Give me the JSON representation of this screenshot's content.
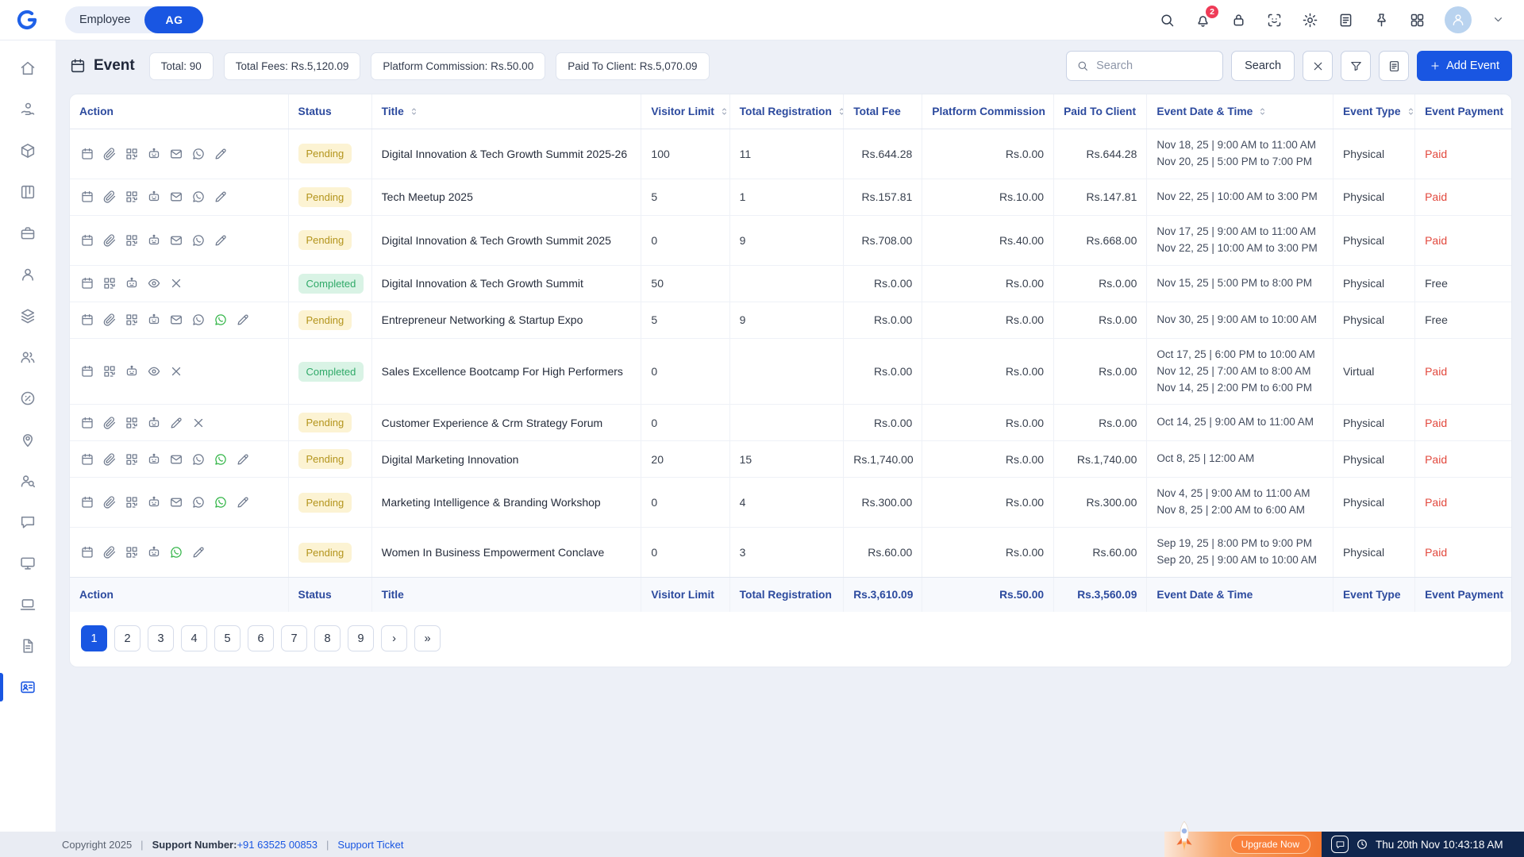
{
  "colors": {
    "accent": "#1956e2",
    "table_header_text": "#2c4a9e",
    "pending_bg": "#fcf3d3",
    "pending_text": "#b3941c",
    "completed_bg": "#d9f3e5",
    "completed_text": "#2fa968",
    "paid_text": "#e2483d",
    "status_bar_navy": "#10264d",
    "upgrade_orange": "#f2762e"
  },
  "topbar": {
    "workspace_tabs": {
      "employee": "Employee",
      "initials": "AG"
    },
    "notification_badge": "2",
    "icons": [
      {
        "icon": "search",
        "name": "topbar-search-button"
      },
      {
        "icon": "bell",
        "name": "notifications-button",
        "badge": "2"
      },
      {
        "icon": "lock",
        "name": "lock-button"
      },
      {
        "icon": "scan",
        "name": "face-scan-button"
      },
      {
        "icon": "gear",
        "name": "settings-button"
      },
      {
        "icon": "note",
        "name": "notes-shortcut-button"
      },
      {
        "icon": "pin",
        "name": "pin-button"
      },
      {
        "icon": "grid",
        "name": "apps-grid-button"
      }
    ]
  },
  "sidebar": {
    "items": [
      {
        "icon": "home",
        "name": "home"
      },
      {
        "icon": "hand-coin",
        "name": "payments"
      },
      {
        "icon": "cube",
        "name": "packages"
      },
      {
        "icon": "kanban",
        "name": "board"
      },
      {
        "icon": "briefcase",
        "name": "jobs"
      },
      {
        "icon": "user",
        "name": "profile"
      },
      {
        "icon": "layers",
        "name": "services"
      },
      {
        "icon": "users",
        "name": "team"
      },
      {
        "icon": "discount",
        "name": "offers"
      },
      {
        "icon": "map-pin",
        "name": "locations"
      },
      {
        "icon": "user-search",
        "name": "candidates"
      },
      {
        "icon": "chat",
        "name": "messages"
      },
      {
        "icon": "monitor",
        "name": "training"
      },
      {
        "icon": "laptop",
        "name": "devices"
      },
      {
        "icon": "document",
        "name": "documents"
      },
      {
        "icon": "id-card",
        "name": "events",
        "active": true
      }
    ]
  },
  "page_header": {
    "title": "Event",
    "badges": [
      "Total: 90",
      "Total Fees: Rs.5,120.09",
      "Platform Commission: Rs.50.00",
      "Paid To Client: Rs.5,070.09"
    ],
    "search": {
      "placeholder": "Search",
      "button": "Search"
    },
    "add_event": "Add Event"
  },
  "table": {
    "columns": [
      {
        "label": "Action",
        "key": "actions",
        "sortable": false
      },
      {
        "label": "Status",
        "key": "status",
        "sortable": false
      },
      {
        "label": "Title",
        "key": "title",
        "sortable": true
      },
      {
        "label": "Visitor Limit",
        "key": "visitor_limit",
        "sortable": true
      },
      {
        "label": "Total Registration",
        "key": "total_registration",
        "sortable": true
      },
      {
        "label": "Total Fee",
        "key": "total_fee",
        "sortable": false
      },
      {
        "label": "Platform Commission",
        "key": "platform_commission",
        "sortable": false
      },
      {
        "label": "Paid To Client",
        "key": "paid_to_client",
        "sortable": false
      },
      {
        "label": "Event Date & Time",
        "key": "dates",
        "sortable": true
      },
      {
        "label": "Event Type",
        "key": "event_type",
        "sortable": true
      },
      {
        "label": "Event Payment",
        "key": "event_payment",
        "sortable": false
      }
    ],
    "rows": [
      {
        "actions": [
          "calendar",
          "paperclip",
          "qr",
          "robot",
          "mail",
          "whatsapp",
          "pencil"
        ],
        "status": "Pending",
        "title": "Digital Innovation & Tech Growth Summit 2025-26",
        "visitor_limit": "100",
        "total_registration": "11",
        "total_fee": "Rs.644.28",
        "platform_commission": "Rs.0.00",
        "paid_to_client": "Rs.644.28",
        "dates": [
          "Nov 18, 25 | 9:00 AM to 11:00 AM",
          "Nov 20, 25 | 5:00 PM to 7:00 PM"
        ],
        "event_type": "Physical",
        "event_payment": "Paid"
      },
      {
        "actions": [
          "calendar",
          "paperclip",
          "qr",
          "robot",
          "mail",
          "whatsapp",
          "pencil"
        ],
        "status": "Pending",
        "title": "Tech Meetup 2025",
        "visitor_limit": "5",
        "total_registration": "1",
        "total_fee": "Rs.157.81",
        "platform_commission": "Rs.10.00",
        "paid_to_client": "Rs.147.81",
        "dates": [
          "Nov 22, 25 | 10:00 AM to 3:00 PM"
        ],
        "event_type": "Physical",
        "event_payment": "Paid"
      },
      {
        "actions": [
          "calendar",
          "paperclip",
          "qr",
          "robot",
          "mail",
          "whatsapp",
          "pencil"
        ],
        "status": "Pending",
        "title": "Digital Innovation & Tech Growth Summit 2025",
        "visitor_limit": "0",
        "total_registration": "9",
        "total_fee": "Rs.708.00",
        "platform_commission": "Rs.40.00",
        "paid_to_client": "Rs.668.00",
        "dates": [
          "Nov 17, 25 | 9:00 AM to 11:00 AM",
          "Nov 22, 25 | 10:00 AM to 3:00 PM"
        ],
        "event_type": "Physical",
        "event_payment": "Paid"
      },
      {
        "actions": [
          "calendar",
          "qr",
          "robot",
          "eye",
          "x"
        ],
        "status": "Completed",
        "title": "Digital Innovation & Tech Growth Summit",
        "visitor_limit": "50",
        "total_registration": "",
        "total_fee": "Rs.0.00",
        "platform_commission": "Rs.0.00",
        "paid_to_client": "Rs.0.00",
        "dates": [
          "Nov 15, 25 | 5:00 PM to 8:00 PM"
        ],
        "event_type": "Physical",
        "event_payment": "Free"
      },
      {
        "actions": [
          "calendar",
          "paperclip",
          "qr",
          "robot",
          "mail",
          "whatsapp",
          "whatsapp-green",
          "pencil"
        ],
        "status": "Pending",
        "title": "Entrepreneur Networking & Startup Expo",
        "visitor_limit": "5",
        "total_registration": "9",
        "total_fee": "Rs.0.00",
        "platform_commission": "Rs.0.00",
        "paid_to_client": "Rs.0.00",
        "dates": [
          "Nov 30, 25 | 9:00 AM to 10:00 AM"
        ],
        "event_type": "Physical",
        "event_payment": "Free"
      },
      {
        "actions": [
          "calendar",
          "qr",
          "robot",
          "eye",
          "x"
        ],
        "status": "Completed",
        "title": "Sales Excellence Bootcamp For High Performers",
        "visitor_limit": "0",
        "total_registration": "",
        "total_fee": "Rs.0.00",
        "platform_commission": "Rs.0.00",
        "paid_to_client": "Rs.0.00",
        "dates": [
          "Oct 17, 25 | 6:00 PM to 10:00 AM",
          "Nov 12, 25 | 7:00 AM to 8:00 AM",
          "Nov 14, 25 | 2:00 PM to 6:00 PM"
        ],
        "event_type": "Virtual",
        "event_payment": "Paid"
      },
      {
        "actions": [
          "calendar",
          "paperclip",
          "qr",
          "robot",
          "pencil",
          "x"
        ],
        "status": "Pending",
        "title": "Customer Experience & Crm Strategy Forum",
        "visitor_limit": "0",
        "total_registration": "",
        "total_fee": "Rs.0.00",
        "platform_commission": "Rs.0.00",
        "paid_to_client": "Rs.0.00",
        "dates": [
          "Oct 14, 25 | 9:00 AM to 11:00 AM"
        ],
        "event_type": "Physical",
        "event_payment": "Paid"
      },
      {
        "actions": [
          "calendar",
          "paperclip",
          "qr",
          "robot",
          "mail",
          "whatsapp",
          "whatsapp-green",
          "pencil"
        ],
        "status": "Pending",
        "title": "Digital Marketing Innovation",
        "visitor_limit": "20",
        "total_registration": "15",
        "total_fee": "Rs.1,740.00",
        "platform_commission": "Rs.0.00",
        "paid_to_client": "Rs.1,740.00",
        "dates": [
          "Oct 8, 25 | 12:00 AM"
        ],
        "event_type": "Physical",
        "event_payment": "Paid"
      },
      {
        "actions": [
          "calendar",
          "paperclip",
          "qr",
          "robot",
          "mail",
          "whatsapp",
          "whatsapp-green",
          "pencil"
        ],
        "status": "Pending",
        "title": "Marketing Intelligence & Branding Workshop",
        "visitor_limit": "0",
        "total_registration": "4",
        "total_fee": "Rs.300.00",
        "platform_commission": "Rs.0.00",
        "paid_to_client": "Rs.300.00",
        "dates": [
          "Nov 4, 25 | 9:00 AM to 11:00 AM",
          "Nov 8, 25 | 2:00 AM to 6:00 AM"
        ],
        "event_type": "Physical",
        "event_payment": "Paid"
      },
      {
        "actions": [
          "calendar",
          "paperclip",
          "qr",
          "robot",
          "whatsapp-green",
          "pencil"
        ],
        "status": "Pending",
        "title": "Women In Business Empowerment Conclave",
        "visitor_limit": "0",
        "total_registration": "3",
        "total_fee": "Rs.60.00",
        "platform_commission": "Rs.0.00",
        "paid_to_client": "Rs.60.00",
        "dates": [
          "Sep 19, 25 | 8:00 PM to 9:00 PM",
          "Sep 20, 25 | 9:00 AM to 10:00 AM"
        ],
        "event_type": "Physical",
        "event_payment": "Paid"
      }
    ],
    "footer_row": {
      "actions": "Action",
      "status": "Status",
      "title": "Title",
      "visitor_limit": "Visitor Limit",
      "total_registration": "Total Registration",
      "total_fee": "Rs.3,610.09",
      "platform_commission": "Rs.50.00",
      "paid_to_client": "Rs.3,560.09",
      "dates": "Event Date & Time",
      "event_type": "Event Type",
      "event_payment": "Event Payment"
    }
  },
  "pagination": {
    "pages": [
      "1",
      "2",
      "3",
      "4",
      "5",
      "6",
      "7",
      "8",
      "9"
    ],
    "next": "›",
    "last": "»",
    "active": "1"
  },
  "footer": {
    "copyright": "Copyright 2025",
    "divider": "|",
    "support_label": "Support Number:",
    "support_phone": "+91 63525 00853",
    "support_ticket": "Support Ticket",
    "upgrade_label": "Upgrade Now",
    "datetime": "Thu 20th Nov 10:43:18 AM"
  }
}
